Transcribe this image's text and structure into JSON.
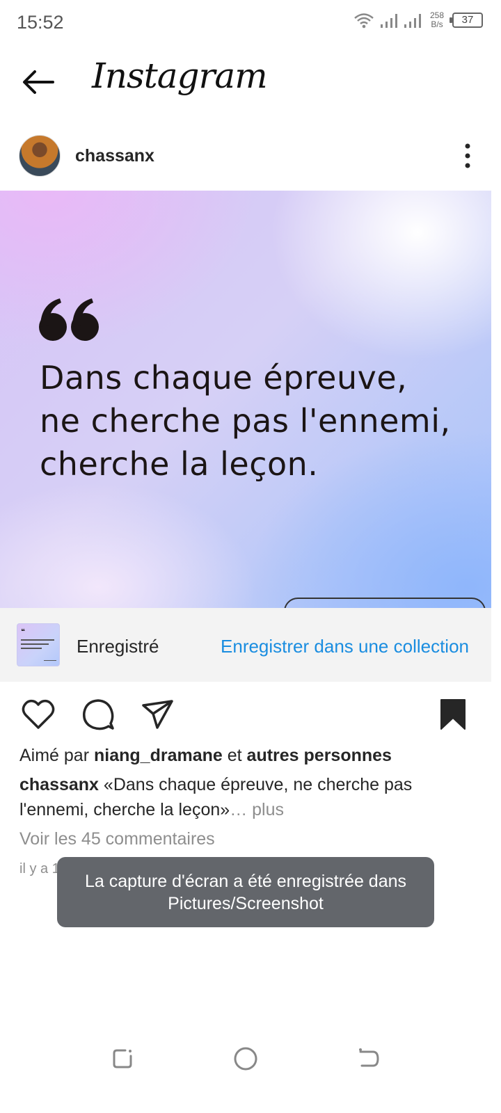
{
  "status_bar": {
    "time": "15:52",
    "net_speed_value": "258",
    "net_speed_unit": "B/s",
    "battery": "37",
    "icons": [
      "wifi-icon",
      "signal-icon",
      "signal-icon",
      "battery-icon"
    ]
  },
  "header": {
    "title": "Instagram",
    "back_icon": "arrow-left-icon"
  },
  "post": {
    "username": "chassanx",
    "quote_mark": "66",
    "quote_text": "Dans chaque épreuve, ne cherche pas l'ennemi, cherche la leçon.",
    "more_icon": "more-vertical-icon"
  },
  "saved_banner": {
    "label": "Enregistré",
    "action": "Enregistrer dans une collection"
  },
  "actions": {
    "icons": [
      "heart-icon",
      "comment-icon",
      "share-icon",
      "bookmark-filled-icon"
    ]
  },
  "likes": {
    "prefix": "Aimé par",
    "user": "niang_dramane",
    "conjunction": "et",
    "others": "autres personnes"
  },
  "caption": {
    "username": "chassanx",
    "text": "«Dans chaque épreuve, ne cherche pas l'ennemi, cherche la leçon»",
    "more": "… plus"
  },
  "comments_link": "Voir les 45 commentaires",
  "post_time": "il y a 1 jour",
  "toast": "La capture d'écran a été enregistrée dans Pictures/Screenshot",
  "nav": {
    "icons": [
      "recents-icon",
      "home-icon",
      "back-icon"
    ]
  },
  "colors": {
    "link_blue": "#1a8de0",
    "toast_bg": "#63666b",
    "muted_text": "#8e8e8e"
  }
}
